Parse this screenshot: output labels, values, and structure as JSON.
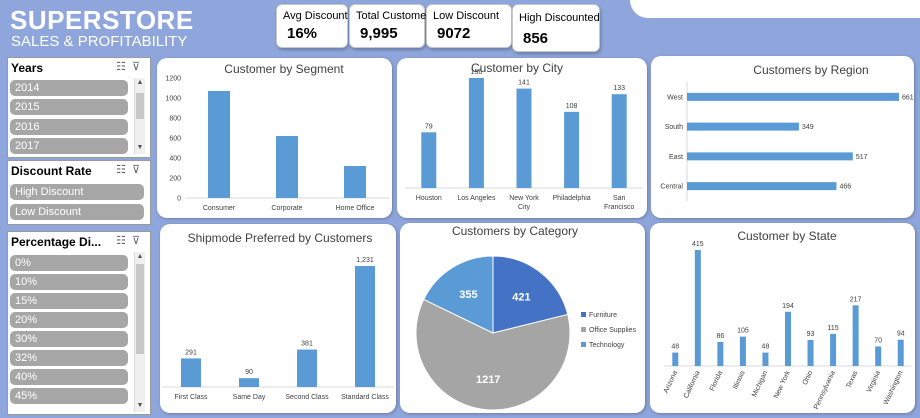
{
  "header": {
    "title": "SUPERSTORE",
    "subtitle": "SALES & PROFITABILITY"
  },
  "kpis": [
    {
      "label": "Avg Discount",
      "value": "16%"
    },
    {
      "label": "Total Customers",
      "value": "9,995"
    },
    {
      "label": "Low Discount",
      "value": "9072"
    },
    {
      "label": "High Discounted",
      "value": "856"
    }
  ],
  "slicers": {
    "years": {
      "title": "Years",
      "items": [
        "2014",
        "2015",
        "2016",
        "2017"
      ]
    },
    "discount_rate": {
      "title": "Discount Rate",
      "items": [
        "High Discount",
        "Low Discount"
      ]
    },
    "percentage": {
      "title": "Percentage Di...",
      "items": [
        "0%",
        "10%",
        "15%",
        "20%",
        "30%",
        "32%",
        "40%",
        "45%"
      ]
    }
  },
  "colors": {
    "bar": "#5b9bd5",
    "furniture": "#4472c4",
    "office_supplies": "#a5a5a5",
    "technology": "#5b9bd5",
    "background": "#8fa6dc"
  },
  "chart_data": [
    {
      "id": "segment",
      "type": "bar",
      "title": "Customer by Segment",
      "categories": [
        "Consumer",
        "Corporate",
        "Home Office"
      ],
      "values": [
        1070,
        620,
        320
      ],
      "ylim": [
        0,
        1200
      ],
      "yticks": [
        "0",
        "200",
        "400",
        "600",
        "800",
        "1000",
        "1200"
      ]
    },
    {
      "id": "city",
      "type": "bar",
      "title": "Customer by City",
      "categories": [
        "Houston",
        "Los Angeles",
        "New York City",
        "Philadelphia",
        "San Francisco"
      ],
      "values": [
        79,
        156,
        141,
        108,
        133
      ]
    },
    {
      "id": "region",
      "type": "bar",
      "orientation": "horizontal",
      "title": "Customers by Region",
      "categories": [
        "West",
        "South",
        "East",
        "Central"
      ],
      "values": [
        661,
        349,
        517,
        466
      ]
    },
    {
      "id": "shipmode",
      "type": "bar",
      "title": "Shipmode Preferred by Customers",
      "categories": [
        "First Class",
        "Same Day",
        "Second Class",
        "Standard Class"
      ],
      "values": [
        291,
        90,
        381,
        1231
      ],
      "value_labels": [
        "291",
        "90",
        "381",
        "1,231"
      ]
    },
    {
      "id": "category",
      "type": "pie",
      "title": "Customers by Category",
      "categories": [
        "Furniture",
        "Office Supplies",
        "Technology"
      ],
      "values": [
        421,
        1217,
        355
      ]
    },
    {
      "id": "state",
      "type": "bar",
      "title": "Customer by State",
      "categories": [
        "Arizona",
        "California",
        "Florida",
        "Illinois",
        "Michigan",
        "New York",
        "Ohio",
        "Pennsylvania",
        "Texas",
        "Virginia",
        "Washington"
      ],
      "values": [
        48,
        415,
        86,
        105,
        48,
        194,
        93,
        115,
        217,
        70,
        94
      ]
    }
  ]
}
